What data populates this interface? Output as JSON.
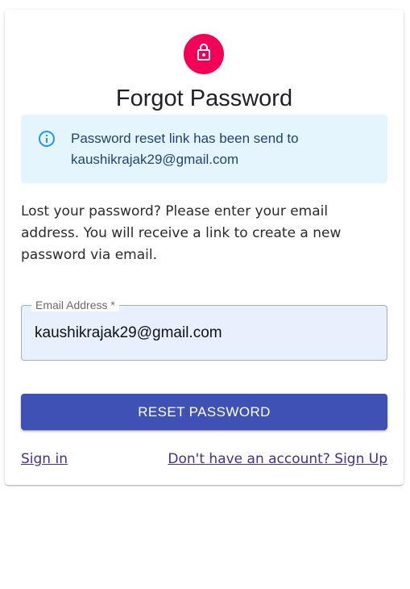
{
  "colors": {
    "avatar_bg": "#f50057",
    "primary": "#3f51b5",
    "alert_bg": "#e5f5fd",
    "alert_icon": "#2196f3",
    "link": "#4a2e86"
  },
  "header": {
    "icon": "lock-icon",
    "title": "Forgot Password"
  },
  "alert": {
    "icon": "info-icon",
    "line1": "Password reset link has been send to",
    "line2": "kaushikrajak29@gmail.com"
  },
  "description": "Lost your password? Please enter your email address. You will receive a link to create a new password via email.",
  "email_field": {
    "label": "Email Address *",
    "value": "kaushikrajak29@gmail.com"
  },
  "reset_button": {
    "label": "RESET PASSWORD"
  },
  "links": {
    "sign_in": "Sign in",
    "sign_up": "Don't have an account? Sign Up"
  }
}
